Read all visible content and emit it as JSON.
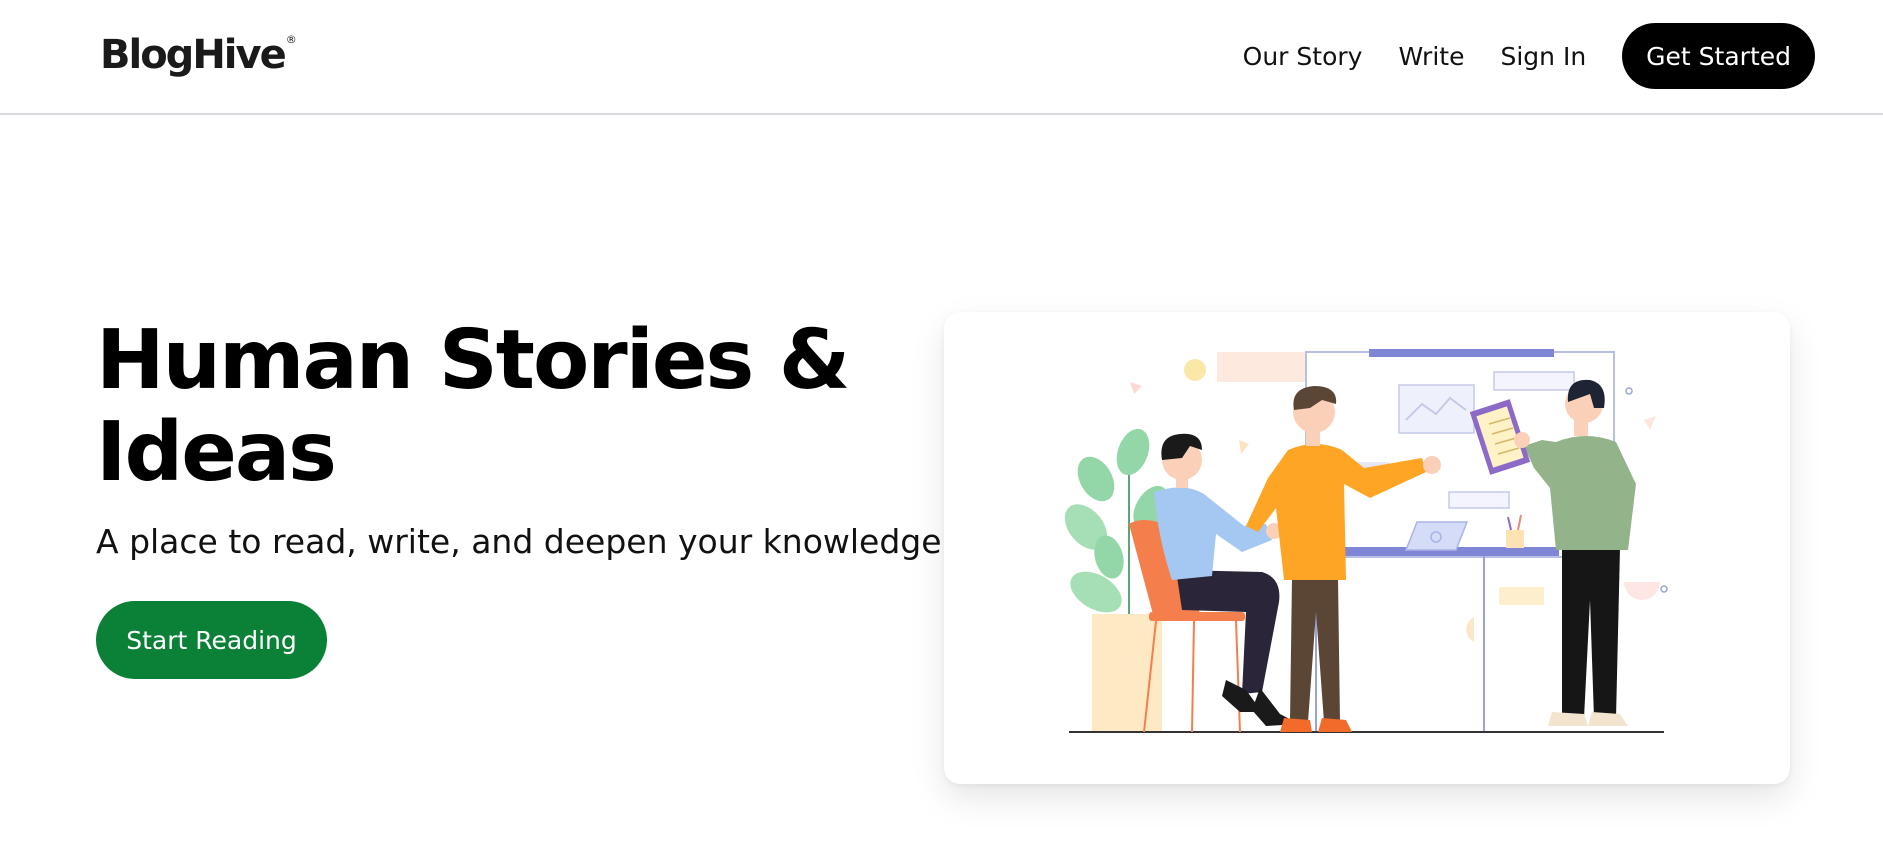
{
  "navbar": {
    "logo": "BlogHive",
    "logo_mark": "®",
    "links": [
      "Our Story",
      "Write",
      "Sign In"
    ],
    "cta": "Get Started"
  },
  "hero": {
    "title": "Human Stories & Ideas",
    "subtitle": "A place to read, write, and deepen your knowledge.",
    "cta": "Start Reading",
    "illustration": "team-collaboration-illustration"
  },
  "colors": {
    "cta_dark": "#000000",
    "cta_green": "#0a8136",
    "divider": "#d8dbe6"
  }
}
